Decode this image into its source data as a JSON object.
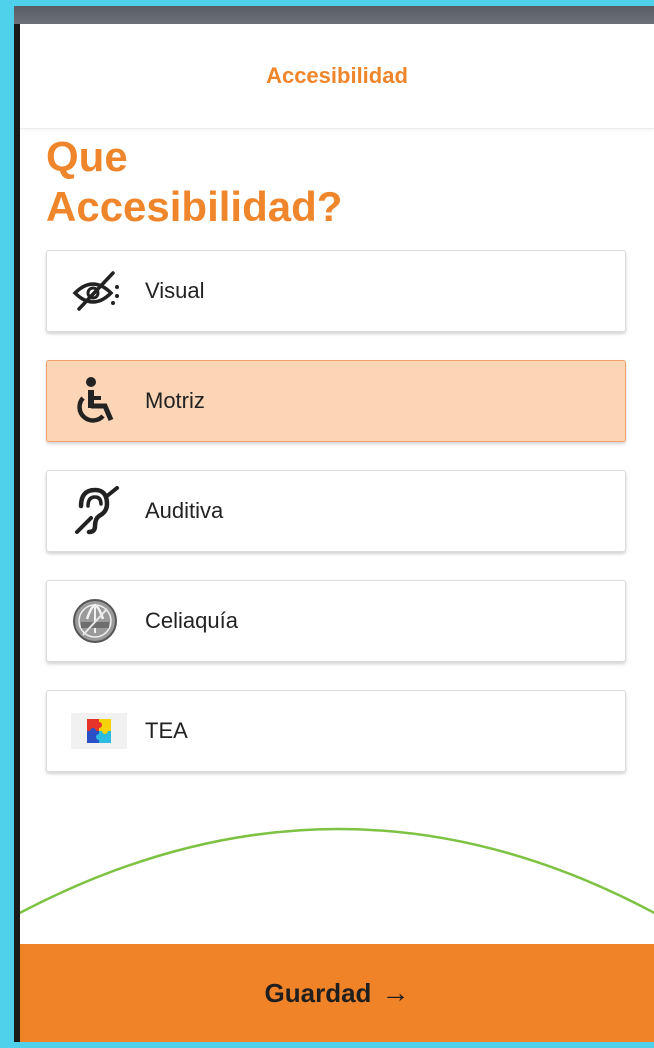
{
  "header": {
    "title": "Accesibilidad"
  },
  "heading": {
    "line1": "Que",
    "line2": "Accesibilidad?"
  },
  "options": [
    {
      "label": "Visual",
      "icon": "eye-slash-icon",
      "selected": false
    },
    {
      "label": "Motriz",
      "icon": "wheelchair-icon",
      "selected": true
    },
    {
      "label": "Auditiva",
      "icon": "hearing-icon",
      "selected": false
    },
    {
      "label": "Celiaquía",
      "icon": "sin-tacc-icon",
      "selected": false
    },
    {
      "label": "TEA",
      "icon": "puzzle-icon",
      "selected": false
    }
  ],
  "footer": {
    "save_label": "Guardad",
    "arrow": "→"
  },
  "colors": {
    "accent": "#f08328",
    "selected_bg": "#fbd5b6",
    "frame": "#4fd1ec",
    "arc": "#7dc242"
  }
}
